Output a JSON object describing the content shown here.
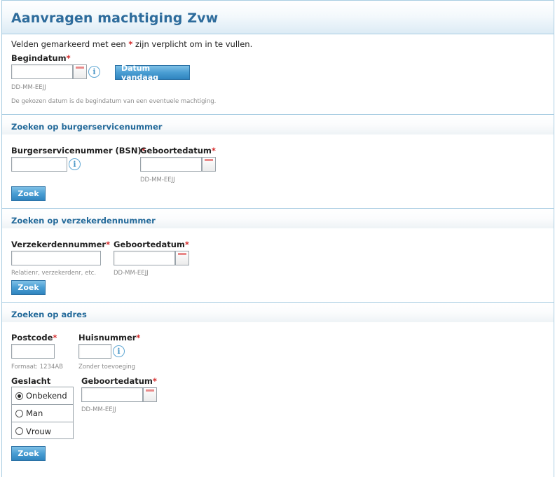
{
  "header": {
    "title": "Aanvragen machtiging Zvw"
  },
  "intro": {
    "required_note_before": "Velden gemarkeerd met een ",
    "required_star": "*",
    "required_note_after": " zijn verplicht om in te vullen."
  },
  "start_date": {
    "label": "Begindatum",
    "value": "",
    "format_hint": "DD-MM-EEJJ",
    "today_button": "Datum vandaag",
    "description": "De gekozen datum is de begindatum van een eventuele machtiging."
  },
  "bsn_section": {
    "title": "Zoeken op burgerservicenummer",
    "bsn_label": "Burgerservicenummer (BSN)",
    "bsn_value": "",
    "dob_label": "Geboortedatum",
    "dob_value": "",
    "dob_hint": "DD-MM-EEJJ",
    "search_button": "Zoek"
  },
  "insured_section": {
    "title": "Zoeken op verzekerdennummer",
    "number_label": "Verzekerdennummer",
    "number_value": "",
    "number_hint": "Relatienr, verzekerdenr, etc.",
    "dob_label": "Geboortedatum",
    "dob_value": "",
    "dob_hint": "DD-MM-EEJJ",
    "search_button": "Zoek"
  },
  "address_section": {
    "title": "Zoeken op adres",
    "postcode_label": "Postcode",
    "postcode_value": "",
    "postcode_hint": "Formaat: 1234AB",
    "house_label": "Huisnummer",
    "house_value": "",
    "house_hint": "Zonder toevoeging",
    "gender_label": "Geslacht",
    "gender_options": [
      "Onbekend",
      "Man",
      "Vrouw"
    ],
    "gender_selected": "Onbekend",
    "dob_label": "Geboortedatum",
    "dob_value": "",
    "dob_hint": "DD-MM-EEJJ",
    "search_button": "Zoek"
  },
  "colors": {
    "title": "#2e6c9c",
    "section_title": "#246a9a",
    "required_star": "#d42a2a",
    "button": "#3a8fc8",
    "border": "#a9cde2"
  },
  "icons": {
    "info": "info-icon",
    "calendar": "calendar-icon"
  }
}
